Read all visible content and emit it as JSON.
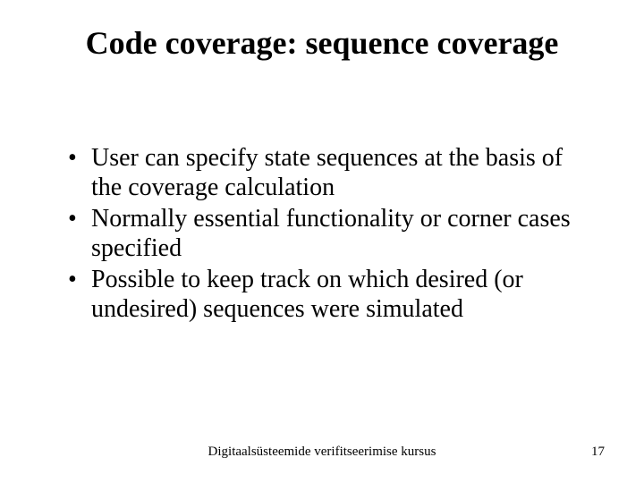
{
  "title": "Code coverage: sequence coverage",
  "bullets": [
    "User can specify state sequences at the basis of the coverage calculation",
    "Normally essential functionality or corner cases specified",
    "Possible to keep track on which desired (or undesired) sequences were simulated"
  ],
  "footer": {
    "center": "Digitaalsüsteemide verifitseerimise kursus",
    "page": "17"
  }
}
